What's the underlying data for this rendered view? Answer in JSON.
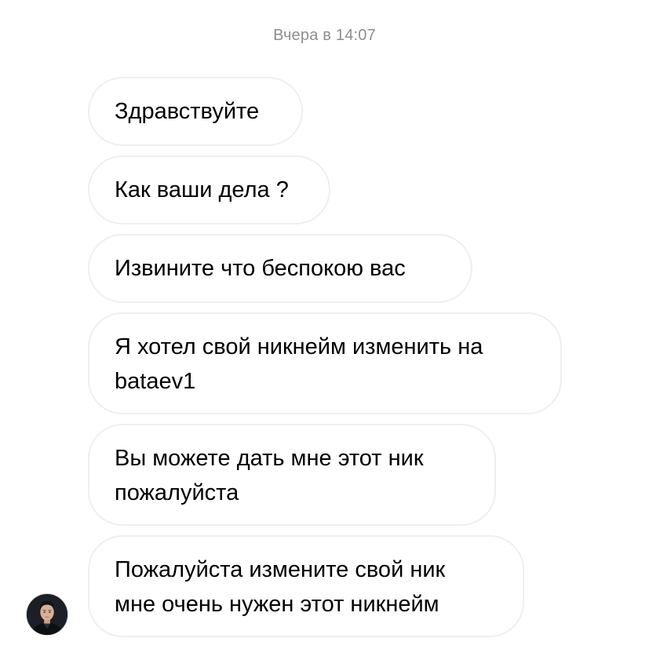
{
  "chat": {
    "timestamp": "Вчера в 14:07",
    "messages": [
      {
        "lines": [
          "Здравствуйте"
        ]
      },
      {
        "lines": [
          "Как ваши дела ?"
        ]
      },
      {
        "lines": [
          "Извините что беспокою вас"
        ]
      },
      {
        "lines": [
          "Я хотел свой никнейм изменить на",
          "bataev1"
        ]
      },
      {
        "lines": [
          "Вы можете дать мне этот ник",
          "пожалуйста"
        ]
      },
      {
        "lines": [
          "Пожалуйста измените свой ник",
          "мне очень нужен этот никнейм"
        ]
      }
    ],
    "sender_avatar_icon": "user-avatar-photo"
  },
  "colors": {
    "background": "#ffffff",
    "bubble_border": "#efefef",
    "timestamp_text": "#8e8e8e",
    "message_text": "#000000"
  }
}
